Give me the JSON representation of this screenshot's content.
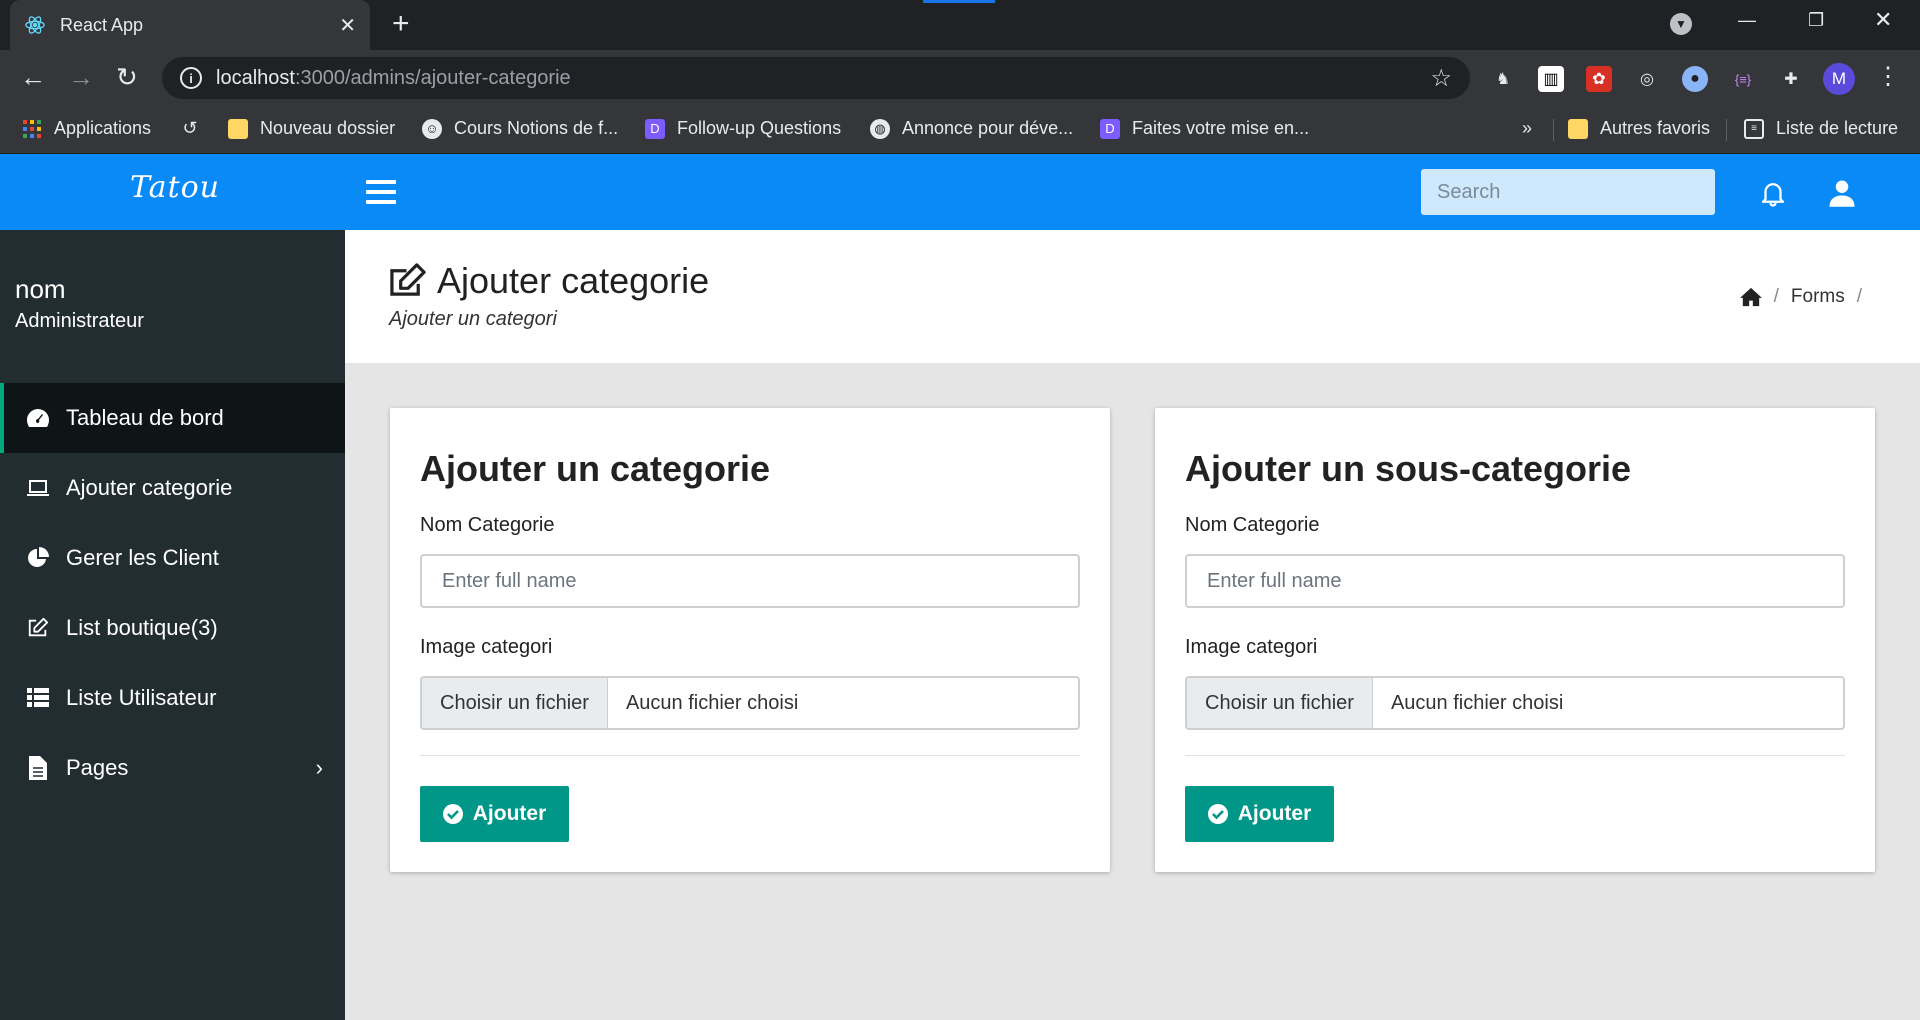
{
  "browser": {
    "tab_title": "React App",
    "url_host": "localhost",
    "url_path": ":3000/admins/ajouter-categorie",
    "profile_initial": "M",
    "bookmarks": [
      "Applications",
      "Nouveau dossier",
      "Cours Notions de f...",
      "Follow-up Questions",
      "Annonce pour déve...",
      "Faites votre mise en..."
    ],
    "bookmarks_overflow": "»",
    "other_favorites": "Autres favoris",
    "reading_list": "Liste de lecture"
  },
  "header": {
    "brand": "Tatou",
    "search_placeholder": "Search"
  },
  "sidebar": {
    "user_name": "nom",
    "user_role": "Administrateur",
    "items": [
      {
        "label": "Tableau de bord",
        "icon": "dashboard-icon",
        "active": true
      },
      {
        "label": "Ajouter categorie",
        "icon": "laptop-icon"
      },
      {
        "label": "Gerer les Client",
        "icon": "pie-chart-icon"
      },
      {
        "label": "List boutique(3)",
        "icon": "edit-icon"
      },
      {
        "label": "Liste Utilisateur",
        "icon": "list-icon"
      },
      {
        "label": "Pages",
        "icon": "file-icon",
        "has_submenu": true
      }
    ]
  },
  "page": {
    "title": "Ajouter categorie",
    "subtitle": "Ajouter un categori",
    "breadcrumb": [
      "Forms"
    ]
  },
  "cards": [
    {
      "title": "Ajouter un categorie",
      "name_label": "Nom Categorie",
      "name_placeholder": "Enter full name",
      "image_label": "Image categori",
      "file_button": "Choisir un fichier",
      "file_status": "Aucun fichier choisi",
      "submit": "Ajouter"
    },
    {
      "title": "Ajouter un sous-categorie",
      "name_label": "Nom Categorie",
      "name_placeholder": "Enter full name",
      "image_label": "Image categori",
      "file_button": "Choisir un fichier",
      "file_status": "Aucun fichier choisi",
      "submit": "Ajouter"
    }
  ],
  "colors": {
    "header_blue": "#0a8af7",
    "sidebar_bg": "#222d32",
    "active_accent": "#00a97a",
    "button_teal": "#009688"
  }
}
